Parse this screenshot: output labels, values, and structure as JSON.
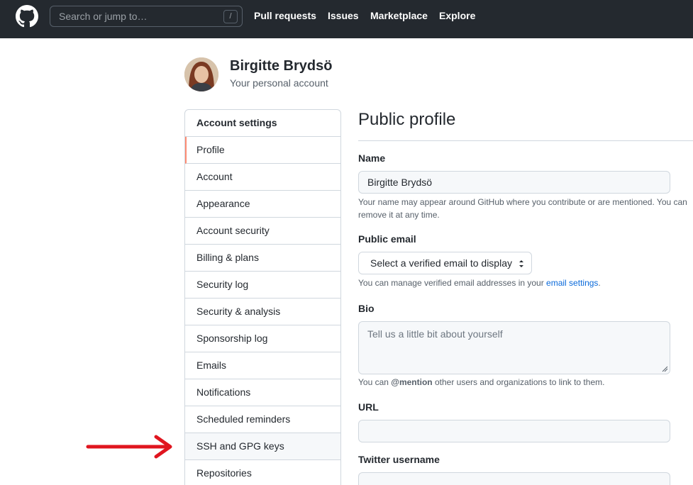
{
  "header": {
    "search_placeholder": "Search or jump to…",
    "search_shortcut": "/",
    "nav": [
      "Pull requests",
      "Issues",
      "Marketplace",
      "Explore"
    ]
  },
  "account": {
    "name": "Birgitte Brydsö",
    "subtitle": "Your personal account"
  },
  "sidebar": {
    "heading": "Account settings",
    "items": [
      {
        "label": "Profile"
      },
      {
        "label": "Account"
      },
      {
        "label": "Appearance"
      },
      {
        "label": "Account security"
      },
      {
        "label": "Billing & plans"
      },
      {
        "label": "Security log"
      },
      {
        "label": "Security & analysis"
      },
      {
        "label": "Sponsorship log"
      },
      {
        "label": "Emails"
      },
      {
        "label": "Notifications"
      },
      {
        "label": "Scheduled reminders"
      },
      {
        "label": "SSH and GPG keys"
      },
      {
        "label": "Repositories"
      }
    ]
  },
  "main": {
    "title": "Public profile",
    "name_label": "Name",
    "name_value": "Birgitte Brydsö",
    "name_note": "Your name may appear around GitHub where you contribute or are mentioned. You can remove it at any time.",
    "email_label": "Public email",
    "email_select": "Select a verified email to display",
    "email_note_pre": "You can manage verified email addresses in your ",
    "email_note_link": "email settings",
    "email_note_post": ".",
    "bio_label": "Bio",
    "bio_placeholder": "Tell us a little bit about yourself",
    "bio_note_pre": "You can ",
    "bio_note_mention": "@mention",
    "bio_note_post": " other users and organizations to link to them.",
    "url_label": "URL",
    "twitter_label": "Twitter username"
  },
  "colors": {
    "header_bg": "#24292f",
    "selected_marker": "#fd8c73",
    "link": "#0969da",
    "annotation_arrow": "#e0151f"
  }
}
